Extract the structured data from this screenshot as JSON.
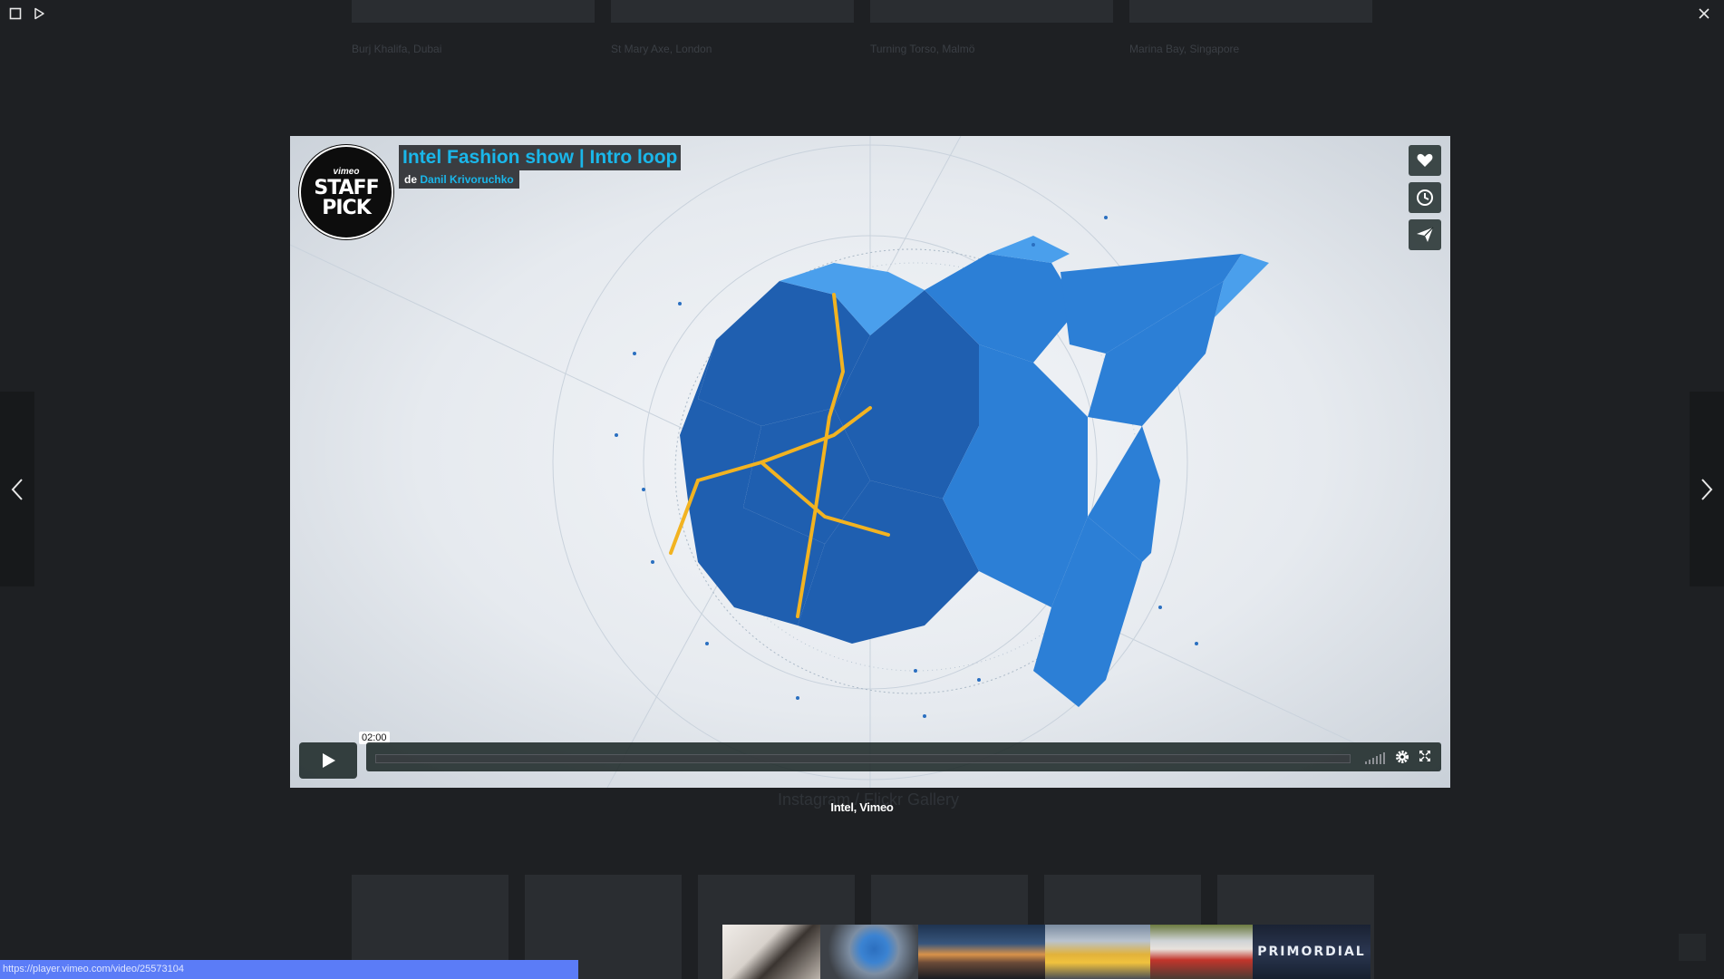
{
  "background": {
    "top_captions": [
      "Burj Khalifa, Dubai",
      "St Mary Axe, London",
      "Turning Torso, Malmö",
      "Marina Bay, Singapore"
    ],
    "gallery_title": "Instagram / Flickr Gallery"
  },
  "toolbar": {
    "fullscreen_icon": "square-icon",
    "slideshow_icon": "play-outline-icon",
    "close_icon": "close-icon"
  },
  "video": {
    "badge_brand": "vimeo",
    "badge_text": "STAFF PICK",
    "title": "Intel Fashion show | Intro loop",
    "byline_prefix": "de",
    "author": "Danil Krivoruchko",
    "time": "02:00",
    "side_buttons": [
      "heart-icon",
      "clock-icon",
      "send-icon"
    ],
    "accent_color": "#1ab7ea"
  },
  "lightbox": {
    "caption": "Intel, Vimeo"
  },
  "thumbnails": [
    {
      "name": "thumb-figure"
    },
    {
      "name": "thumb-intel-shape"
    },
    {
      "name": "thumb-sunset-city"
    },
    {
      "name": "thumb-yellow-taxi"
    },
    {
      "name": "thumb-red-car"
    },
    {
      "name": "thumb-primordial",
      "label": "PRIMORDIAL"
    }
  ],
  "status_bar": {
    "url": "https://player.vimeo.com/video/25573104"
  }
}
